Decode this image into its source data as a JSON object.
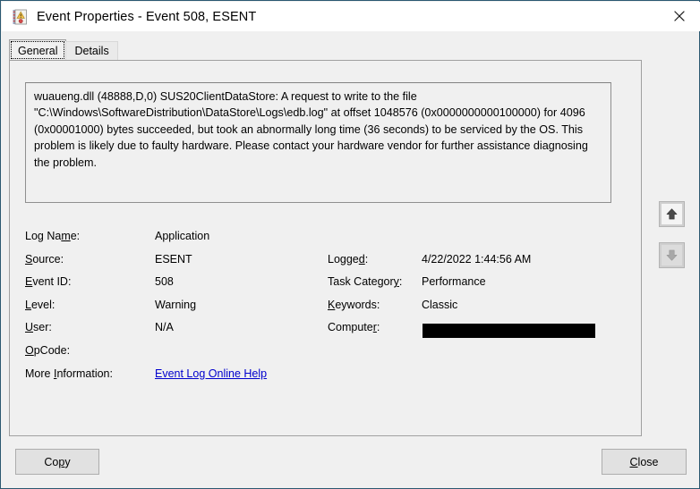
{
  "window": {
    "title": "Event Properties - Event 508, ESENT",
    "icon": "event-log-icon",
    "close_icon": "close-icon"
  },
  "tabs": [
    {
      "label": "General",
      "selected": true
    },
    {
      "label": "Details",
      "selected": false
    }
  ],
  "message": "wuaueng.dll (48888,D,0) SUS20ClientDataStore: A request to write to the file \"C:\\Windows\\SoftwareDistribution\\DataStore\\Logs\\edb.log\" at offset 1048576 (0x0000000000100000) for 4096 (0x00001000) bytes succeeded, but took an abnormally long time (36 seconds) to be serviced by the OS. This problem is likely due to faulty hardware. Please contact your hardware vendor for further assistance diagnosing the problem.",
  "details": {
    "left": [
      {
        "label_pre": "Log Na",
        "label_mn": "m",
        "label_post": "e:",
        "value": "Application"
      },
      {
        "label_pre": "",
        "label_mn": "S",
        "label_post": "ource:",
        "value": "ESENT"
      },
      {
        "label_pre": "",
        "label_mn": "E",
        "label_post": "vent ID:",
        "value": "508"
      },
      {
        "label_pre": "",
        "label_mn": "L",
        "label_post": "evel:",
        "value": "Warning"
      },
      {
        "label_pre": "",
        "label_mn": "U",
        "label_post": "ser:",
        "value": "N/A"
      },
      {
        "label_pre": "",
        "label_mn": "O",
        "label_post": "pCode:",
        "value": ""
      },
      {
        "label_pre": "More ",
        "label_mn": "I",
        "label_post": "nformation:",
        "value": "Event Log Online Help",
        "is_link": true
      }
    ],
    "right": [
      {
        "label_pre": "Logge",
        "label_mn": "d",
        "label_post": ":",
        "value": "4/22/2022 1:44:56 AM"
      },
      {
        "label_pre": "Task Categor",
        "label_mn": "y",
        "label_post": ":",
        "value": "Performance"
      },
      {
        "label_pre": "",
        "label_mn": "K",
        "label_post": "eywords:",
        "value": "Classic"
      },
      {
        "label_pre": "Compute",
        "label_mn": "r",
        "label_post": ":",
        "value": "",
        "redacted": true
      }
    ]
  },
  "nav": {
    "up_icon": "arrow-up-icon",
    "down_icon": "arrow-down-icon",
    "up_enabled": true,
    "down_enabled": false
  },
  "buttons": {
    "copy": {
      "pre": "Co",
      "mn": "p",
      "post": "y"
    },
    "close": {
      "pre": "",
      "mn": "C",
      "post": "lose"
    }
  },
  "colors": {
    "window_bg": "#f0f0f0",
    "titlebar_bg": "#ffffff",
    "frame_border": "#2b5871",
    "link": "#0000cd",
    "redaction": "#000000"
  }
}
